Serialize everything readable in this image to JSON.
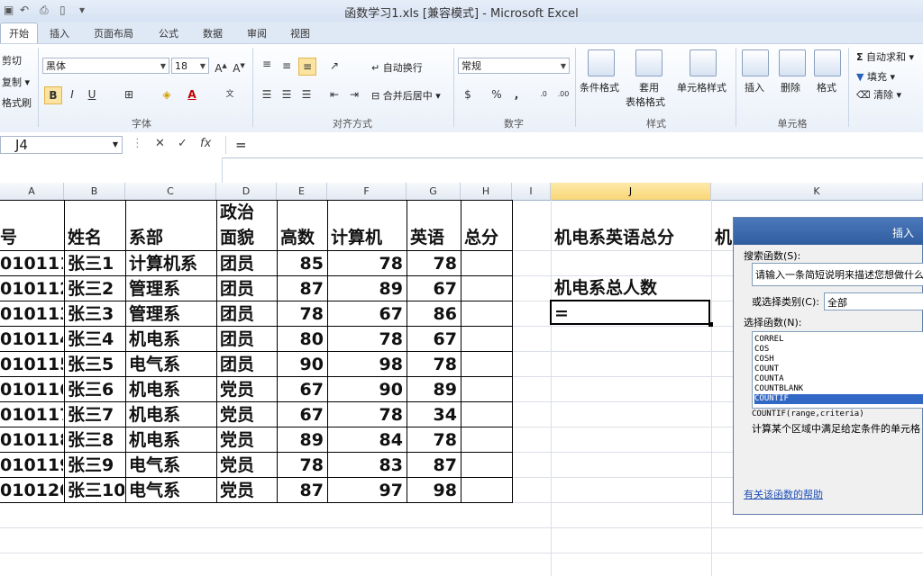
{
  "window": {
    "title": "函数学习1.xls  [兼容模式]  -  Microsoft Excel"
  },
  "tabs": [
    "开始",
    "插入",
    "页面布局",
    "公式",
    "数据",
    "审阅",
    "视图"
  ],
  "ribbon": {
    "clipboard": {
      "cut": "剪切",
      "copy": "复制 ▾",
      "format_painter": "格式刷"
    },
    "font": {
      "name": "黑体",
      "size": "18",
      "bold": "B",
      "italic": "I",
      "underline": "U",
      "group_label": "字体"
    },
    "alignment": {
      "wrap": "自动换行",
      "merge": "合并后居中 ▾",
      "group_label": "对齐方式"
    },
    "number": {
      "format": "常规",
      "percent": "%",
      "comma": ",",
      "group_label": "数字"
    },
    "styles": {
      "conditional": "条件格式",
      "table_1": "套用",
      "table_2": "表格格式",
      "cell_styles": "单元格样式",
      "group_label": "样式"
    },
    "cells": {
      "insert": "插入",
      "delete": "删除",
      "format": "格式",
      "group_label": "单元格"
    },
    "editing": {
      "autosum": "自动求和 ▾",
      "fill": "填充 ▾",
      "clear": "清除 ▾"
    }
  },
  "formula_bar": {
    "name_box": "J4",
    "fx": "fx",
    "content": "="
  },
  "columns": [
    "A",
    "B",
    "C",
    "D",
    "E",
    "F",
    "G",
    "H",
    "I",
    "J",
    "K"
  ],
  "table": {
    "header_row": [
      "号",
      "姓名",
      "系部",
      "政治",
      "面貌",
      "高数",
      "计算机",
      "英语",
      "总分"
    ],
    "rows": [
      [
        "010111",
        "张三1",
        "计算机系",
        "团员",
        "85",
        "78",
        "78"
      ],
      [
        "010112",
        "张三2",
        "管理系",
        "团员",
        "87",
        "89",
        "67"
      ],
      [
        "010113",
        "张三3",
        "管理系",
        "团员",
        "78",
        "67",
        "86"
      ],
      [
        "010114",
        "张三4",
        "机电系",
        "团员",
        "80",
        "78",
        "67"
      ],
      [
        "010115",
        "张三5",
        "电气系",
        "团员",
        "90",
        "98",
        "78"
      ],
      [
        "010116",
        "张三6",
        "机电系",
        "党员",
        "67",
        "90",
        "89"
      ],
      [
        "010117",
        "张三7",
        "机电系",
        "党员",
        "67",
        "78",
        "34"
      ],
      [
        "010118",
        "张三8",
        "机电系",
        "党员",
        "89",
        "84",
        "78"
      ],
      [
        "010119",
        "张三9",
        "电气系",
        "党员",
        "78",
        "83",
        "87"
      ],
      [
        "010120",
        "张三10",
        "电气系",
        "党员",
        "87",
        "97",
        "98"
      ]
    ]
  },
  "side_cells": {
    "j_header": "机电系英语总分",
    "k_header_partial": "机",
    "j_count_label": "机电系总人数",
    "j_active": "="
  },
  "dialog": {
    "title": "插入",
    "search_label": "搜索函数(S):",
    "search_value": "请输入一条简短说明来描述您想做什么",
    "category_label": "或选择类别(C):",
    "category_value": "全部",
    "select_label": "选择函数(N):",
    "functions": [
      "CORREL",
      "COS",
      "COSH",
      "COUNT",
      "COUNTA",
      "COUNTBLANK",
      "COUNTIF"
    ],
    "selected_function": "COUNTIF",
    "signature": "COUNTIF(range,criteria)",
    "description": "计算某个区域中满足给定条件的单元格",
    "help_link": "有关该函数的帮助"
  }
}
